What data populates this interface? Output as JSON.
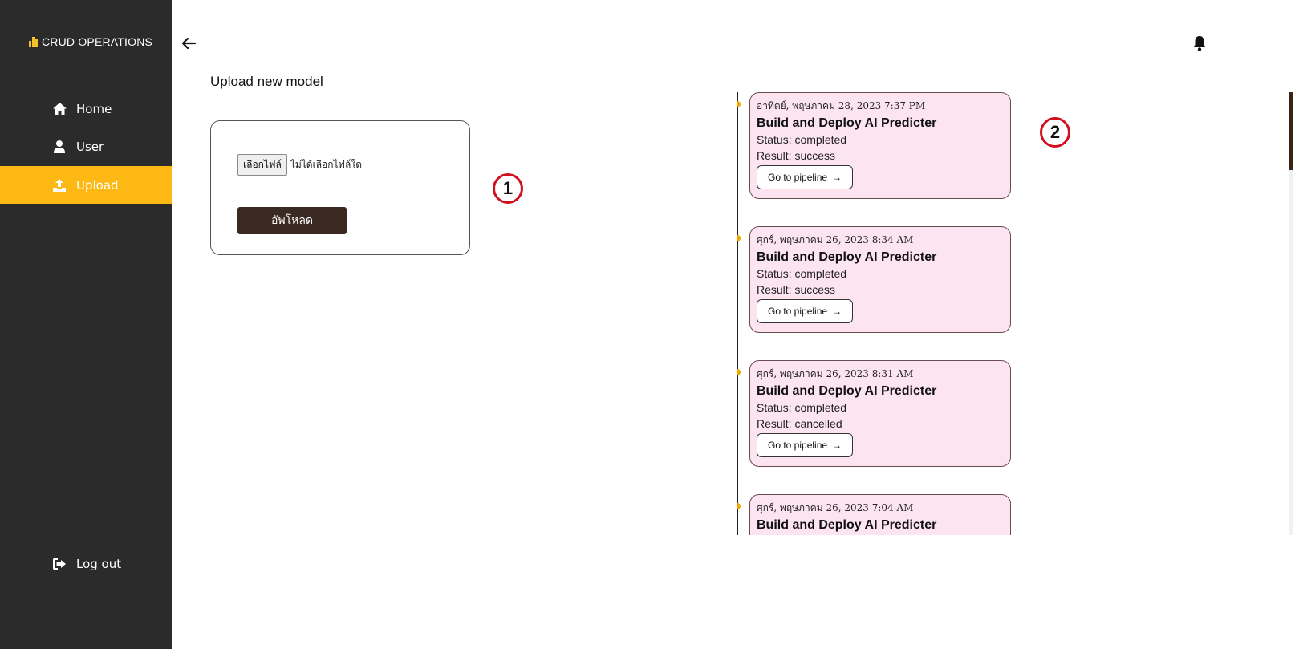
{
  "sidebar": {
    "brand": "CRUD OPERATIONS",
    "items": [
      {
        "label": "Home",
        "icon": "home-icon"
      },
      {
        "label": "User",
        "icon": "user-icon"
      },
      {
        "label": "Upload",
        "icon": "upload-icon",
        "active": true
      }
    ],
    "logout": {
      "label": "Log out",
      "icon": "logout-icon"
    }
  },
  "header": {
    "back_icon": "arrow-left-icon",
    "notification_icon": "bell-icon"
  },
  "upload": {
    "title": "Upload new model",
    "choose_file_label": "เลือกไฟล์",
    "no_file_text": "ไม่ได้เลือกไฟล์ใด",
    "submit_label": "อัพโหลด"
  },
  "markers": [
    "1",
    "2"
  ],
  "timeline": [
    {
      "date": "อาทิตย์, พฤษภาคม 28, 2023 7:37 PM",
      "title": "Build and Deploy AI Predicter",
      "status": "Status: completed",
      "result": "Result: success",
      "button": "Go to pipeline",
      "arrow": "→"
    },
    {
      "date": "ศุกร์, พฤษภาคม 26, 2023 8:34 AM",
      "title": "Build and Deploy AI Predicter",
      "status": "Status: completed",
      "result": "Result: success",
      "button": "Go to pipeline",
      "arrow": "→"
    },
    {
      "date": "ศุกร์, พฤษภาคม 26, 2023 8:31 AM",
      "title": "Build and Deploy AI Predicter",
      "status": "Status: completed",
      "result": "Result: cancelled",
      "button": "Go to pipeline",
      "arrow": "→"
    },
    {
      "date": "ศุกร์, พฤษภาคม 26, 2023 7:04 AM",
      "title": "Build and Deploy AI Predicter",
      "status": "",
      "result": "",
      "button": "",
      "arrow": ""
    }
  ],
  "colors": {
    "sidebar_bg": "#2b2b2b",
    "accent": "#fdb813",
    "card_bg": "#fde4f1",
    "upload_button": "#3b2a22",
    "marker": "#d0101c"
  }
}
